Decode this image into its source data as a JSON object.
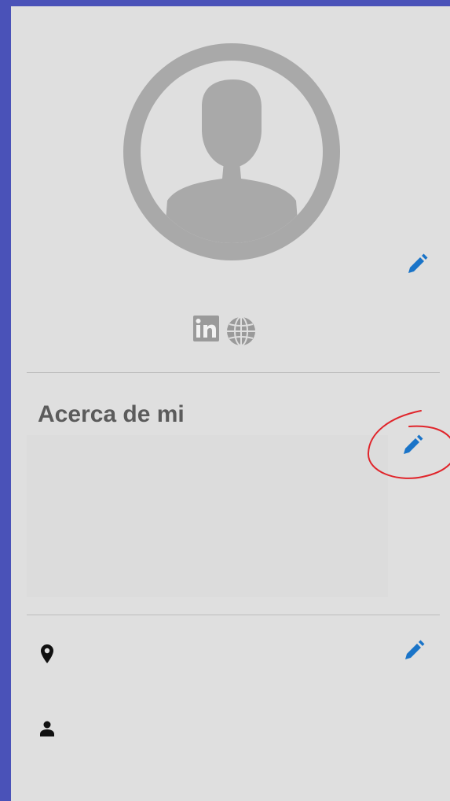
{
  "profile": {
    "avatar_icon": "user-avatar-placeholder",
    "edit_icon": "pencil-icon",
    "social": [
      {
        "name": "linkedin-icon",
        "label": "in"
      },
      {
        "name": "globe-icon"
      }
    ]
  },
  "about": {
    "title": "Acerca de mi",
    "text": "",
    "edit_icon": "pencil-icon"
  },
  "details": {
    "location_icon": "map-pin-icon",
    "location_value": "",
    "person_icon": "person-icon",
    "person_value": "",
    "edit_icon": "pencil-icon"
  },
  "colors": {
    "frame": "#4a52b8",
    "panel": "#dfdfdf",
    "accent": "#1a74c8",
    "avatar": "#a9a9a9",
    "annotation": "#e0252b"
  }
}
